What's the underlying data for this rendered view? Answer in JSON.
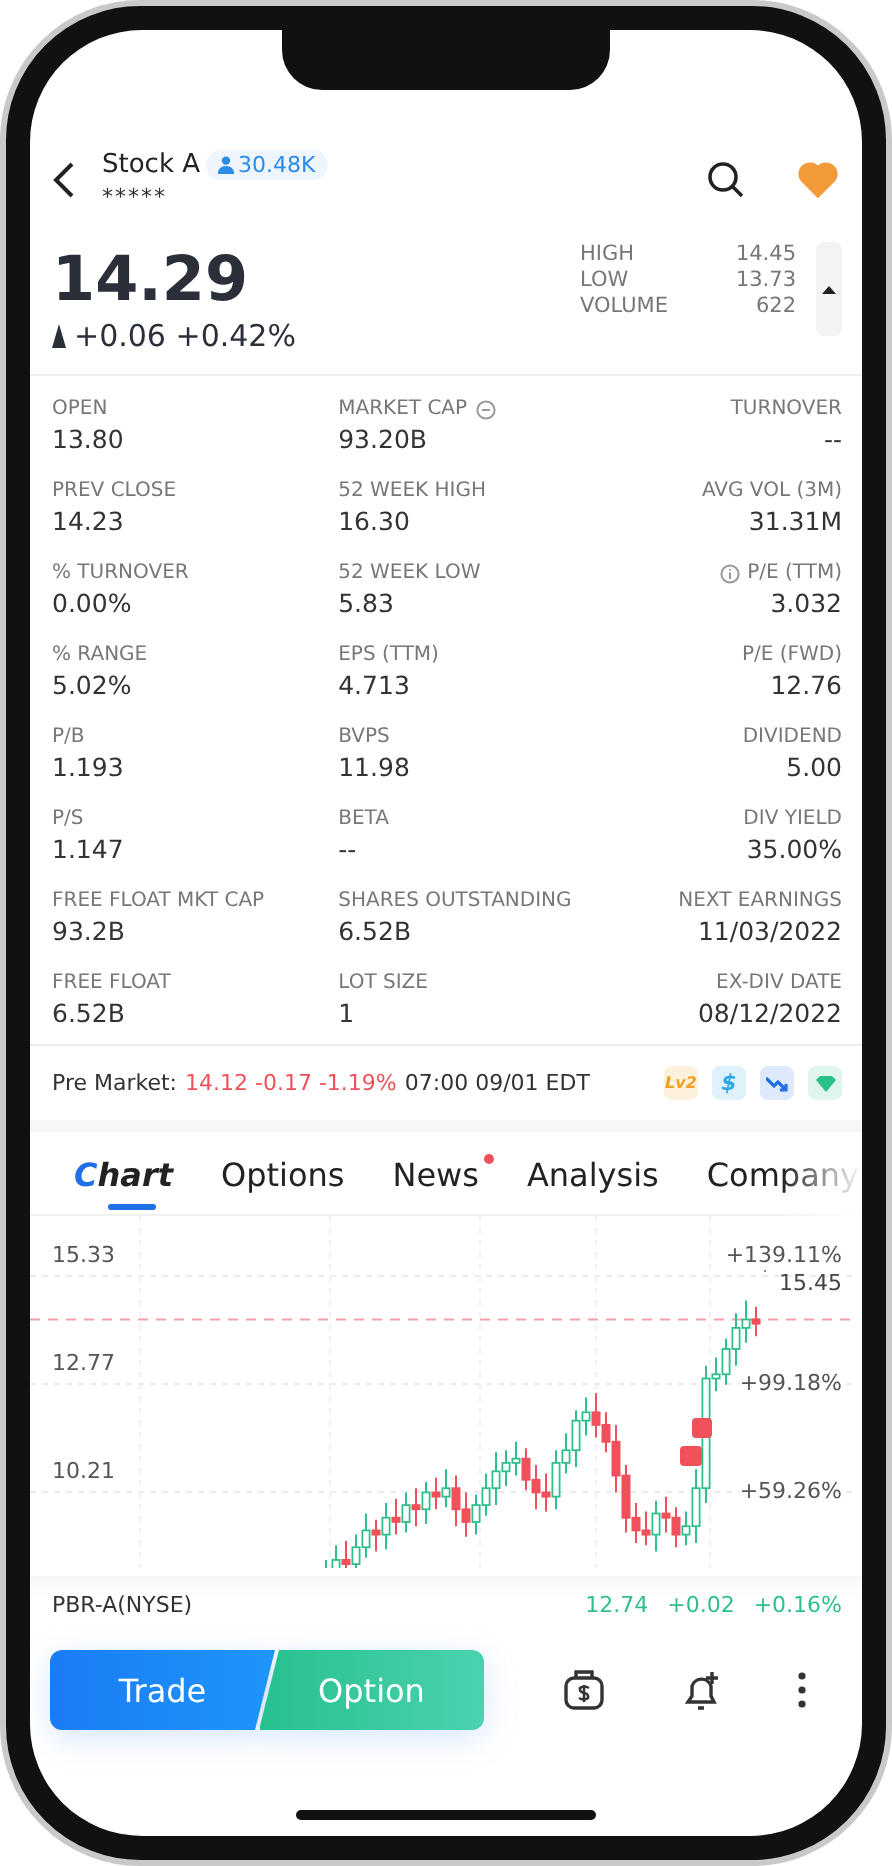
{
  "header": {
    "title": "Stock A",
    "followers": "30.48K",
    "subtitle": "*****",
    "watchlisted": true
  },
  "quote": {
    "price": "14.29",
    "change": "+0.06",
    "percent": "+0.42%",
    "details": [
      {
        "label": "HIGH",
        "value": "14.45"
      },
      {
        "label": "LOW",
        "value": "13.73"
      },
      {
        "label": "VOLUME",
        "value": "622"
      }
    ]
  },
  "stats": [
    {
      "label": "OPEN",
      "value": "13.80"
    },
    {
      "label": "MARKET CAP",
      "value": "93.20B"
    },
    {
      "label": "TURNOVER",
      "value": "--"
    },
    {
      "label": "PREV CLOSE",
      "value": "14.23"
    },
    {
      "label": "52 WEEK HIGH",
      "value": "16.30"
    },
    {
      "label": "AVG VOL (3M)",
      "value": "31.31M"
    },
    {
      "label": "% TURNOVER",
      "value": "0.00%"
    },
    {
      "label": "52 WEEK LOW",
      "value": "5.83"
    },
    {
      "label": "P/E (TTM)",
      "value": "3.032"
    },
    {
      "label": "% RANGE",
      "value": "5.02%"
    },
    {
      "label": "EPS (TTM)",
      "value": "4.713"
    },
    {
      "label": "P/E (FWD)",
      "value": "12.76"
    },
    {
      "label": "P/B",
      "value": "1.193"
    },
    {
      "label": "BVPS",
      "value": "11.98"
    },
    {
      "label": "DIVIDEND",
      "value": "5.00"
    },
    {
      "label": "P/S",
      "value": "1.147"
    },
    {
      "label": "BETA",
      "value": "--"
    },
    {
      "label": "DIV YIELD",
      "value": "35.00%"
    },
    {
      "label": "FREE FLOAT MKT CAP",
      "value": "93.2B"
    },
    {
      "label": "SHARES OUTSTANDING",
      "value": "6.52B"
    },
    {
      "label": "NEXT EARNINGS",
      "value": "11/03/2022"
    },
    {
      "label": "FREE FLOAT",
      "value": "6.52B"
    },
    {
      "label": "LOT SIZE",
      "value": "1"
    },
    {
      "label": "EX-DIV DATE",
      "value": "08/12/2022"
    }
  ],
  "pre_market": {
    "label": "Pre Market:",
    "change": "14.12 -0.17 -1.19%",
    "time": "07:00 09/01 EDT",
    "badges": [
      {
        "kind": "text",
        "text": "Lv2",
        "color": "#f0a020"
      },
      {
        "kind": "text",
        "text": "$",
        "color": "#2aa7e6"
      },
      {
        "kind": "trend",
        "color": "#1f6fe6"
      },
      {
        "kind": "gem",
        "color": "#2bbf8a"
      }
    ]
  },
  "tabs": [
    {
      "label": "Chart",
      "selected": true,
      "dot": false
    },
    {
      "label": "Options",
      "selected": false,
      "dot": false
    },
    {
      "label": "News",
      "selected": false,
      "dot": true
    },
    {
      "label": "Analysis",
      "selected": false,
      "dot": false
    },
    {
      "label": "Company",
      "selected": false,
      "dot": false
    }
  ],
  "chart": {
    "price_labels": [
      "15.33",
      "12.77",
      "10.21"
    ],
    "percent_labels": [
      "+139.11%",
      "+99.18%",
      "+59.26%"
    ],
    "last_price": "15.45"
  },
  "related": {
    "symbol": "PBR-A(NYSE)",
    "price": "12.74",
    "change": "+0.02",
    "percent": "+0.16%"
  },
  "actions": {
    "buttons": [
      "Trade",
      "Option"
    ]
  }
}
